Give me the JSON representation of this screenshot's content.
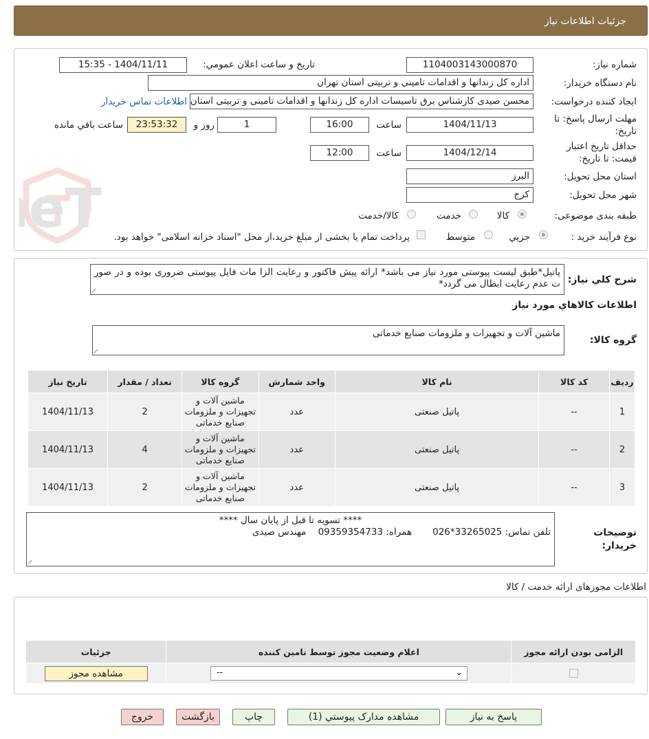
{
  "header": {
    "title": "جزئیات اطلاعات نیاز"
  },
  "form": {
    "need_number_label": "شماره نیاز:",
    "need_number": "1104003143000870",
    "announce_label": "تاریخ و ساعت اعلان عمومي:",
    "announce_value": "1404/11/11 - 15:35",
    "buyer_org_label": "نام دستگاه خریدار:",
    "buyer_org": "اداره کل زندانها و اقدامات تامینی و تربیتی استان تهران",
    "requester_label": "ایجاد کننده درخواست:",
    "requester": "محسن صیدی کارشناس برق تاسیسات  اداره کل زندانها و اقدامات تامینی و تربیتی استان تهران",
    "buyer_contact_link": "اطلاعات تماس خریدار",
    "deadline_label_1": "مهلت ارسال پاسخ: تا",
    "deadline_label_2": "تاریخ:",
    "deadline_date": "1404/11/13",
    "time_label": "ساعت",
    "deadline_time": "16:00",
    "days_value": "1",
    "days_label": "روز و",
    "remaining_time": "23:53:32",
    "remaining_label": "ساعت باقي مانده",
    "min_validity_label_1": "حداقل تاریخ اعتبار",
    "min_validity_label_2": "قیمت: تا تاریخ:",
    "validity_date": "1404/12/14",
    "validity_time_label": "ساعت",
    "validity_time": "12:00",
    "province_label": "استان محل تحویل:",
    "province": "البرز",
    "city_label": "شهر محل تحویل:",
    "city": "کرج",
    "category_label": "طبقه بندی موضوعی:",
    "category_options": [
      "کالا",
      "خدمت",
      "کالا/خدمت"
    ],
    "process_label": "نوع فرآیند خرید :",
    "process_options": [
      "جزیي",
      "متوسط"
    ],
    "payment_note": "پرداخت تمام یا بخشی از مبلغ خرید،از محل \"اسناد خزانه اسلامی\" خواهد بود."
  },
  "description": {
    "label": "شرح کلي نیاز:",
    "text": "پاتیل*طبق لیست پیوستی مورد نیاز می باشد* ارائه پیش فاکتور و رعایت الزا مات فایل پیوستی ضروری بوده و در صور ت عدم رعایت ابطال می گردد*"
  },
  "goods": {
    "section_title": "اطلاعات کالاهاي مورد نیاز",
    "group_label": "گروه کالا:",
    "group_value": "ماشین آلات و تجهیزات و ملزومات صنایع خدماتی",
    "columns": [
      "ردیف",
      "کد کالا",
      "نام کالا",
      "واحد شمارش",
      "گروه کالا",
      "تعداد / مقدار",
      "تاریخ نیاز"
    ],
    "rows": [
      {
        "idx": "1",
        "code": "--",
        "name": "پاتیل صنعتی",
        "unit": "عدد",
        "group": "ماشین آلات و تجهیزات و ملزومات صنایع خدماتی",
        "qty": "2",
        "date": "1404/11/13"
      },
      {
        "idx": "2",
        "code": "--",
        "name": "پاتیل صنعتی",
        "unit": "عدد",
        "group": "ماشین آلات و تجهیزات و ملزومات صنایع خدماتی",
        "qty": "4",
        "date": "1404/11/13"
      },
      {
        "idx": "3",
        "code": "--",
        "name": "پاتیل صنعتی",
        "unit": "عدد",
        "group": "ماشین آلات و تجهیزات و ملزومات صنایع خدماتی",
        "qty": "2",
        "date": "1404/11/13"
      }
    ]
  },
  "buyer_notes": {
    "label_1": "توضیحات",
    "label_2": "خریدار:",
    "line1": "**** تسویه تا قبل از پایان سال ****",
    "line2": "تلفن تماس: 33265025*026       همراه: 09359354733    مهندس صیدی"
  },
  "licenses": {
    "section_title": "اطلاعات مجوزهای ارائه خدمت / کالا",
    "columns": [
      "الزامی بودن ارائه مجوز",
      "اعلام وضعیت مجوز توسط تامین کننده",
      "جزئیات"
    ],
    "select_value": "--",
    "view_button": "مشاهده مجوز"
  },
  "buttons": {
    "reply": "پاسخ به نیاز",
    "attachments": "مشاهده مدارک پیوستي (1)",
    "print": "چاپ",
    "back": "بازگشت",
    "exit": "خروج"
  },
  "watermark": {
    "text": "AriaTender.neT"
  }
}
